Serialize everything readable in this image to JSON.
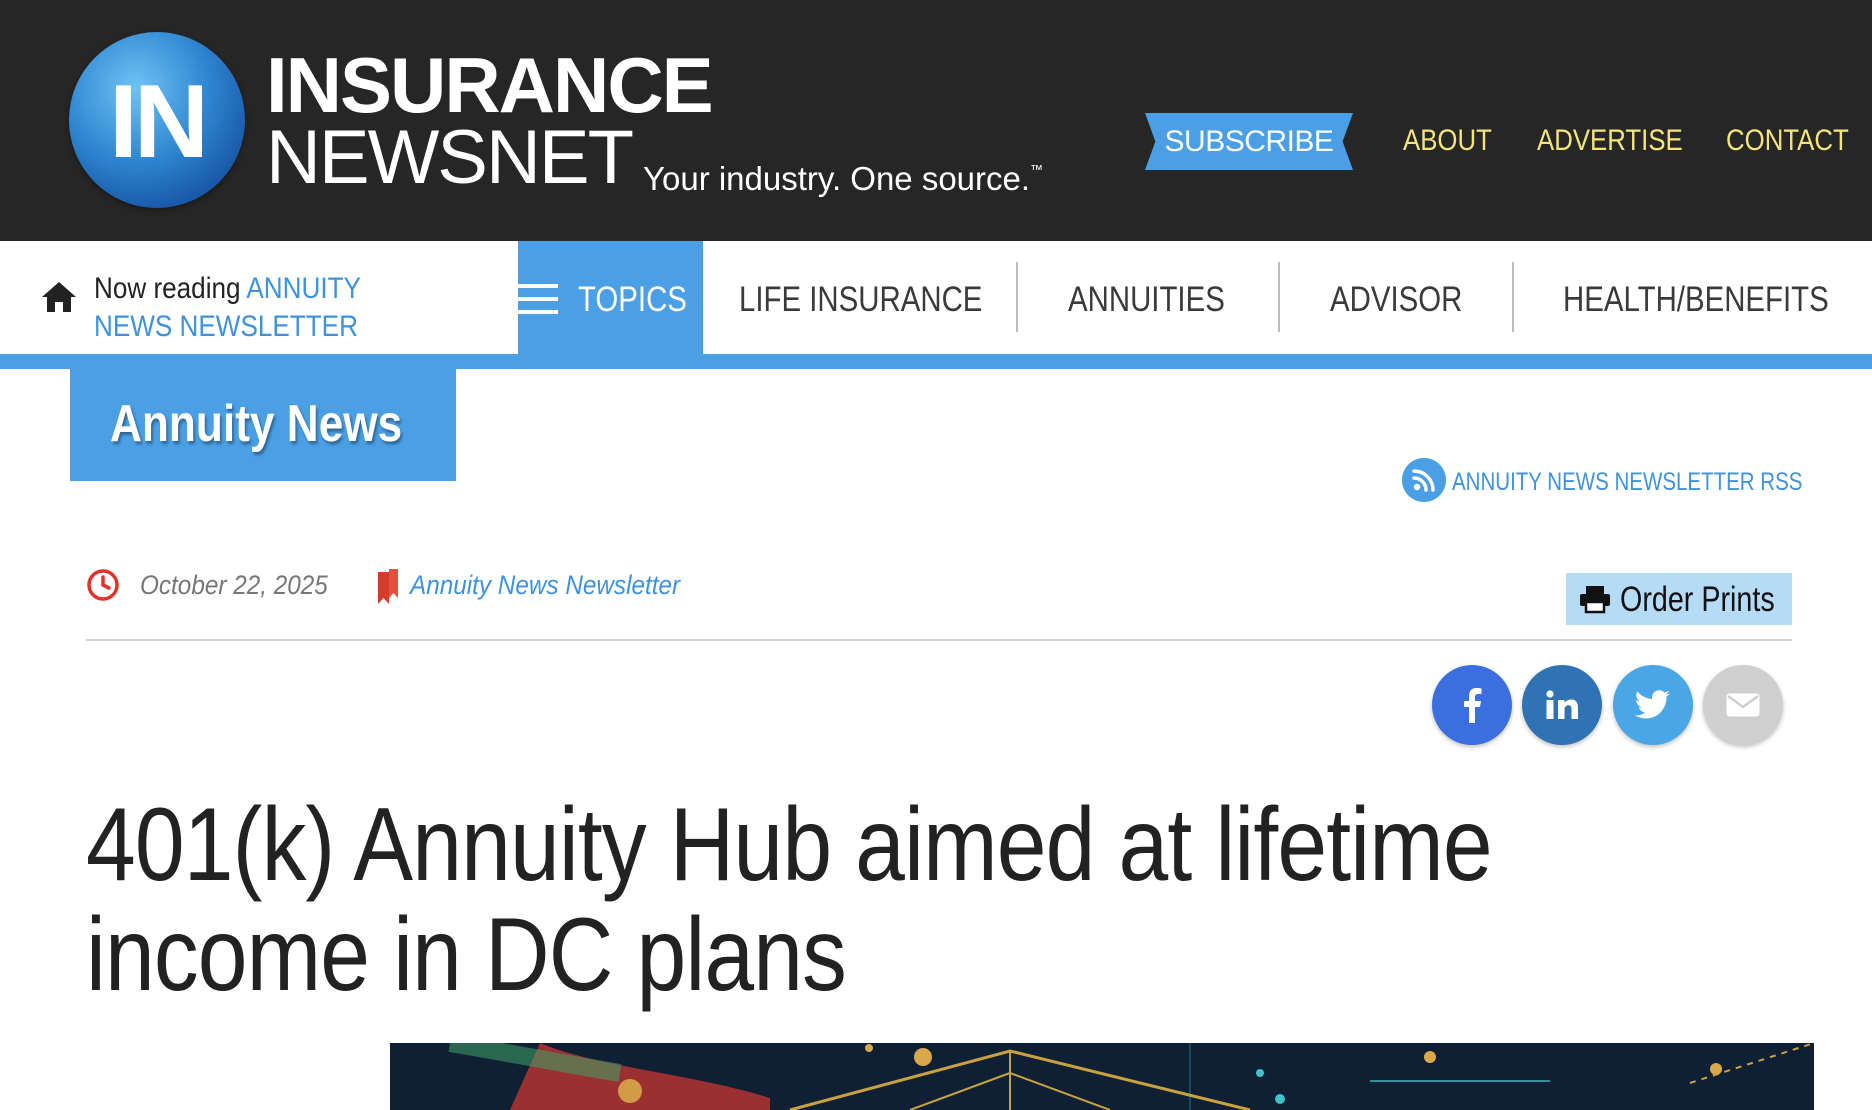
{
  "header": {
    "logo_letters": "IN",
    "brand_line1": "INSURANCE",
    "brand_line2": "NEWSNET",
    "tagline": "Your industry. One source.",
    "tagline_mark": "™",
    "subscribe_label": "SUBSCRIBE",
    "links": [
      "ABOUT",
      "ADVERTISE",
      "CONTACT"
    ]
  },
  "nav": {
    "now_reading_label": "Now reading",
    "now_reading_link": "ANNUITY NEWS NEWSLETTER",
    "topics_label": "TOPICS",
    "items": [
      "LIFE INSURANCE",
      "ANNUITIES",
      "ADVISOR",
      "HEALTH/BENEFITS"
    ]
  },
  "section": {
    "title": "Annuity News",
    "rss_label": "ANNUITY NEWS NEWSLETTER RSS"
  },
  "meta": {
    "date": "October 22, 2025",
    "newsletter": "Annuity News Newsletter",
    "order_prints": "Order Prints"
  },
  "share": {
    "icons": [
      "facebook-icon",
      "linkedin-icon",
      "twitter-icon",
      "email-icon"
    ]
  },
  "article": {
    "headline": "401(k) Annuity Hub aimed at lifetime income in DC plans"
  },
  "colors": {
    "header_bg": "#262626",
    "accent_blue": "#4a9fe5",
    "top_link_yellow": "#f3e57a",
    "clock_red": "#e0342a"
  }
}
